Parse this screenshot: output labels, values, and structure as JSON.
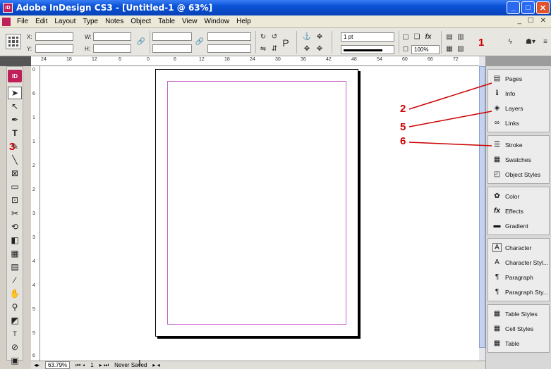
{
  "window": {
    "title": "Adobe InDesign CS3 - [Untitled-1 @ 63%]",
    "app_badge": "ID",
    "minimize_icon": "_",
    "maximize_icon": "□",
    "close_icon": "✕"
  },
  "menubar": {
    "items": [
      "File",
      "Edit",
      "Layout",
      "Type",
      "Notes",
      "Object",
      "Table",
      "View",
      "Window",
      "Help"
    ],
    "right_controls": "_ ☐ ✕"
  },
  "control": {
    "x_label": "X:",
    "y_label": "Y:",
    "w_label": "W:",
    "h_label": "H:",
    "stroke_weight": "1 pt",
    "zoom_value": "100%"
  },
  "ruler": {
    "top_ticks": [
      "24",
      "18",
      "12",
      "6",
      "0",
      "6",
      "12",
      "18",
      "24",
      "30",
      "36",
      "42",
      "48",
      "54",
      "60",
      "66",
      "72"
    ],
    "left_ticks": [
      "0",
      "6",
      "1",
      "1",
      "2",
      "2",
      "3",
      "3",
      "4",
      "4",
      "5",
      "5",
      "6"
    ]
  },
  "toolbox": {
    "badge": "ID",
    "tools": [
      {
        "name": "selection-tool",
        "glyph": "➤"
      },
      {
        "name": "direct-selection-tool",
        "glyph": "↖"
      },
      {
        "name": "pen-tool",
        "glyph": "✒"
      },
      {
        "name": "type-tool",
        "glyph": "T"
      },
      {
        "name": "pencil-tool",
        "glyph": "✎"
      },
      {
        "name": "line-tool",
        "glyph": "╲"
      },
      {
        "name": "rectangle-frame-tool",
        "glyph": "⊠"
      },
      {
        "name": "rectangle-tool",
        "glyph": "▭"
      },
      {
        "name": "button-tool",
        "glyph": "⊡"
      },
      {
        "name": "scissors-tool",
        "glyph": "✂"
      },
      {
        "name": "free-transform-tool",
        "glyph": "⟲"
      },
      {
        "name": "gradient-tool",
        "glyph": "◧"
      },
      {
        "name": "gradient-feather-tool",
        "glyph": "▦"
      },
      {
        "name": "note-tool",
        "glyph": "▤"
      },
      {
        "name": "eyedropper-tool",
        "glyph": "⁄"
      },
      {
        "name": "hand-tool",
        "glyph": "✋"
      },
      {
        "name": "zoom-tool",
        "glyph": "⚲"
      },
      {
        "name": "fill-stroke-swatch",
        "glyph": "◩"
      },
      {
        "name": "formatting-affects",
        "glyph": "T"
      },
      {
        "name": "apply-none",
        "glyph": "⊘"
      },
      {
        "name": "normal-view",
        "glyph": "▣"
      }
    ]
  },
  "dock": {
    "groups": [
      [
        {
          "label": "Pages",
          "icon": "pages-icon",
          "glyph": "▤"
        },
        {
          "label": "Info",
          "icon": "info-icon",
          "glyph": "ℹ"
        },
        {
          "label": "Layers",
          "icon": "layers-icon",
          "glyph": "◈"
        },
        {
          "label": "Links",
          "icon": "links-icon",
          "glyph": "∞"
        }
      ],
      [
        {
          "label": "Stroke",
          "icon": "stroke-icon",
          "glyph": "☰"
        },
        {
          "label": "Swatches",
          "icon": "swatches-icon",
          "glyph": "▦"
        },
        {
          "label": "Object Styles",
          "icon": "object-styles-icon",
          "glyph": "◰"
        }
      ],
      [
        {
          "label": "Color",
          "icon": "color-icon",
          "glyph": "✿"
        },
        {
          "label": "Effects",
          "icon": "effects-icon",
          "glyph": "fx"
        },
        {
          "label": "Gradient",
          "icon": "gradient-icon",
          "glyph": "▬"
        }
      ],
      [
        {
          "label": "Character",
          "icon": "character-icon",
          "glyph": "A"
        },
        {
          "label": "Character Styl...",
          "icon": "character-styles-icon",
          "glyph": "A"
        },
        {
          "label": "Paragraph",
          "icon": "paragraph-icon",
          "glyph": "¶"
        },
        {
          "label": "Paragraph Sty...",
          "icon": "paragraph-styles-icon",
          "glyph": "¶"
        }
      ],
      [
        {
          "label": "Table Styles",
          "icon": "table-styles-icon",
          "glyph": "▦"
        },
        {
          "label": "Cell Styles",
          "icon": "cell-styles-icon",
          "glyph": "▦"
        },
        {
          "label": "Table",
          "icon": "table-icon",
          "glyph": "▦"
        }
      ]
    ]
  },
  "status": {
    "zoom": "63.79%",
    "page": "1",
    "save_state": "Never Saved"
  },
  "callouts": {
    "one": "1",
    "two": "2",
    "three": "3",
    "five": "5",
    "six": "6"
  },
  "colors": {
    "callout": "#cc0000",
    "margin_guide": "#c860c8",
    "title_bar": "#0a52d6"
  }
}
